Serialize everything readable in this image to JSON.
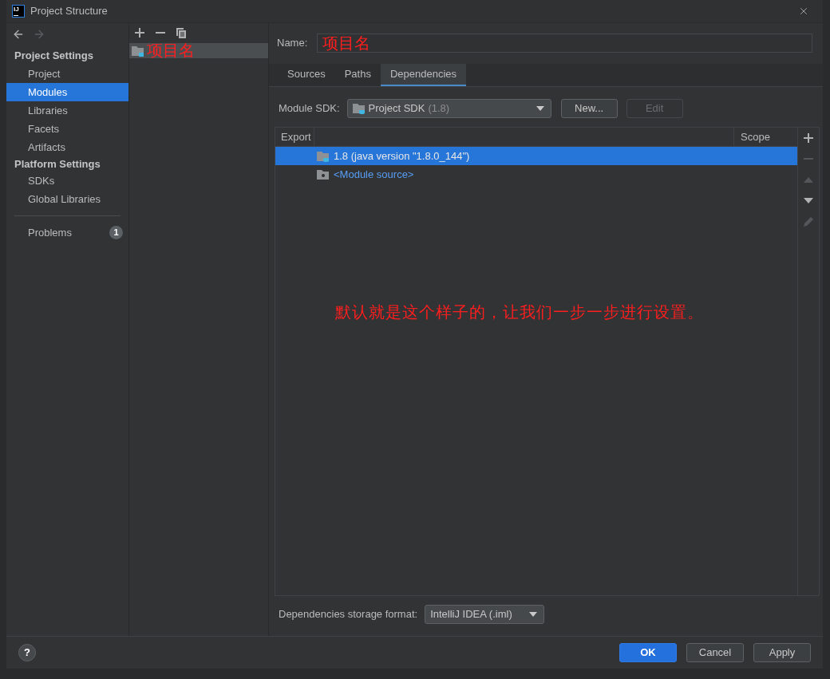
{
  "window": {
    "logo_text": "IJ",
    "title": "Project Structure"
  },
  "nav": {
    "back_disabled": false,
    "forward_disabled": true
  },
  "sidebar": {
    "sections": [
      {
        "title": "Project Settings",
        "items": [
          {
            "label": "Project",
            "selected": false
          },
          {
            "label": "Modules",
            "selected": true
          },
          {
            "label": "Libraries",
            "selected": false
          },
          {
            "label": "Facets",
            "selected": false
          },
          {
            "label": "Artifacts",
            "selected": false
          }
        ]
      },
      {
        "title": "Platform Settings",
        "items": [
          {
            "label": "SDKs",
            "selected": false
          },
          {
            "label": "Global Libraries",
            "selected": false
          }
        ]
      }
    ],
    "problems": {
      "label": "Problems",
      "count": "1"
    }
  },
  "modules": {
    "toolbar": [
      {
        "kind": "add"
      },
      {
        "kind": "remove"
      },
      {
        "kind": "copy"
      }
    ],
    "items": [
      {
        "label": "项目名",
        "selected": true
      }
    ]
  },
  "name_field": {
    "label": "Name:",
    "value": "项目名"
  },
  "tabs": [
    {
      "label": "Sources",
      "selected": false
    },
    {
      "label": "Paths",
      "selected": false
    },
    {
      "label": "Dependencies",
      "selected": true
    }
  ],
  "module_sdk": {
    "label": "Module SDK:",
    "value": "Project SDK",
    "version": "(1.8)",
    "buttons": [
      {
        "label": "New...",
        "disabled": false
      },
      {
        "label": "Edit",
        "disabled": true
      }
    ]
  },
  "dependencies_table": {
    "columns": [
      "Export",
      "Scope"
    ],
    "rows": [
      {
        "kind": "sdk",
        "label": "1.8 (java version \"1.8.0_144\")",
        "selected": true
      },
      {
        "kind": "source",
        "label": "<Module source>",
        "selected": false
      }
    ],
    "toolbar": [
      {
        "kind": "add",
        "disabled": false
      },
      {
        "kind": "remove",
        "disabled": true
      },
      {
        "kind": "up",
        "disabled": true
      },
      {
        "kind": "down",
        "disabled": false
      },
      {
        "kind": "edit",
        "disabled": true
      }
    ]
  },
  "annotation": "默认就是这个样子的，让我们一步一步进行设置。",
  "storage_format": {
    "label": "Dependencies storage format:",
    "value": "IntelliJ IDEA (.iml)"
  },
  "help_button": {
    "label": "?"
  },
  "buttons": [
    {
      "label": "OK",
      "kind": "primary"
    },
    {
      "label": "Cancel",
      "kind": "default"
    },
    {
      "label": "Apply",
      "kind": "default"
    }
  ]
}
